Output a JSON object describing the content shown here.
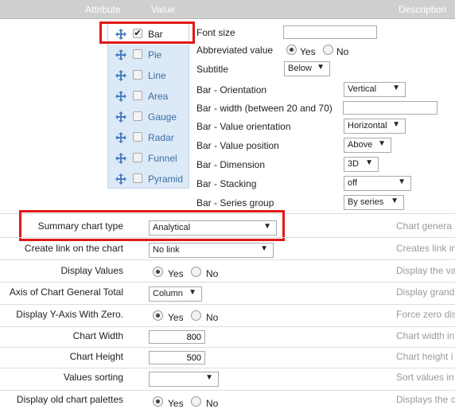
{
  "header": {
    "attribute": "Attribute",
    "value": "Value",
    "description": "Description"
  },
  "chart_types": [
    {
      "label": "Bar",
      "checked": true
    },
    {
      "label": "Pie",
      "checked": false
    },
    {
      "label": "Line",
      "checked": false
    },
    {
      "label": "Area",
      "checked": false
    },
    {
      "label": "Gauge",
      "checked": false
    },
    {
      "label": "Radar",
      "checked": false
    },
    {
      "label": "Funnel",
      "checked": false
    },
    {
      "label": "Pyramid",
      "checked": false
    }
  ],
  "bar_options": {
    "font_size": {
      "label": "Font size",
      "value": ""
    },
    "abbreviated": {
      "label": "Abbreviated value",
      "yes": "Yes",
      "no": "No"
    },
    "subtitle": {
      "label": "Subtitle",
      "value": "Below"
    },
    "orientation": {
      "label": "Bar - Orientation",
      "value": "Vertical"
    },
    "width": {
      "label": "Bar - width (between 20 and 70)",
      "value": ""
    },
    "value_orientation": {
      "label": "Bar - Value orientation",
      "value": "Horizontal"
    },
    "value_position": {
      "label": "Bar - Value position",
      "value": "Above"
    },
    "dimension": {
      "label": "Bar - Dimension",
      "value": "3D"
    },
    "stacking": {
      "label": "Bar - Stacking",
      "value": "off"
    },
    "series_group": {
      "label": "Bar - Series group",
      "value": "By series"
    }
  },
  "settings": {
    "summary_chart_type": {
      "label": "Summary chart type",
      "value": "Analytical",
      "desc": "Chart genera"
    },
    "create_link": {
      "label": "Create link on the chart",
      "value": "No link",
      "desc": "Creates link in"
    },
    "display_values": {
      "label": "Display Values",
      "yes": "Yes",
      "no": "No",
      "desc": "Display the va"
    },
    "axis_general_total": {
      "label": "Axis of Chart General Total",
      "value": "Column",
      "desc": "Display grand"
    },
    "display_y_axis_zero": {
      "label": "Display Y-Axis With Zero.",
      "yes": "Yes",
      "no": "No",
      "desc": "Force zero dis"
    },
    "chart_width": {
      "label": "Chart Width",
      "value": "800",
      "desc": "Chart width in"
    },
    "chart_height": {
      "label": "Chart Height",
      "value": "500",
      "desc": "Chart height i"
    },
    "values_sorting": {
      "label": "Values sorting",
      "value": "",
      "desc": "Sort values in"
    },
    "old_palettes": {
      "label": "Display old chart palettes",
      "yes": "Yes",
      "no": "No",
      "desc": "Displays the c"
    }
  },
  "arrow": "▼",
  "check": "✔"
}
